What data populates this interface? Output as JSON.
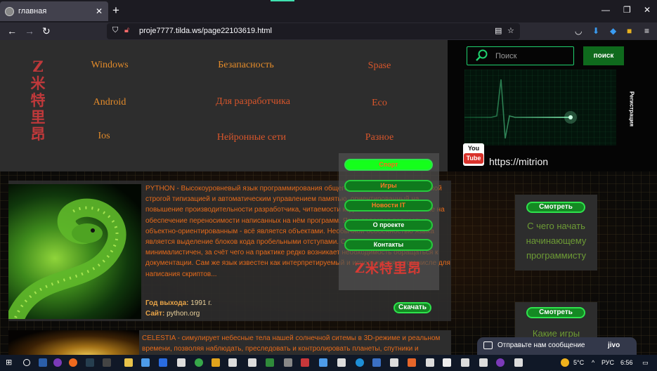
{
  "browser": {
    "tab_title": "главная",
    "tab_close": "✕",
    "new_tab": "+",
    "url": "proje7777.tilda.ws/page22103619.html",
    "window_controls": [
      "—",
      "❐",
      "✕"
    ]
  },
  "header": {
    "logo": "Z米特里昂",
    "nav": [
      {
        "label": "Windows",
        "color": "#e38b2a"
      },
      {
        "label": "Безапасность",
        "color": "#e38b2a"
      },
      {
        "label": "Spase",
        "color": "#d9562b"
      },
      {
        "label": "Android",
        "color": "#e38b2a"
      },
      {
        "label": "Для разработчика",
        "color": "#d9562b"
      },
      {
        "label": "Eco",
        "color": "#d9562b"
      },
      {
        "label": "Ios",
        "color": "#e38b2a"
      },
      {
        "label": "Нейронные сети",
        "color": "#d9562b"
      },
      {
        "label": "Разное",
        "color": "#d9562b"
      }
    ]
  },
  "search": {
    "placeholder": "Поиск",
    "button": "поиск"
  },
  "sidebar": {
    "registration": "Регистрация",
    "youtube_you": "You",
    "youtube_tube": "Tube",
    "youtube_link": "https://mitrion"
  },
  "card1": {
    "description": "PYTHON - Высокоуровневый язык программирования общего назначения с динамической строгой типизацией и автоматическим управлением памятью, ориентированный на повышение производительности разработчика, читаемости кода и его качества, а также на обеспечение переносимости написанных на нём программ. Язык является полностью объектно-ориентированным - всё является объектами. Необычной особенностью языка является выделение блоков кода пробельными отступами. Синтаксис ядра языка минималистичен, за счёт чего на практике редко возникает необходимость обращаться к документации. Сам же язык известен как интерпретируемый и используется в том числе для написания скриптов...",
    "release_label": "Год выхода:",
    "release_value": "1991 г.",
    "site_label": "Сайт:",
    "site_value": "python.org",
    "download": "Скачать"
  },
  "card2": {
    "description": "CELESTIA - симулирует небесные тела нашей солнечной ситемы в 3D-режиме и реальном времени, позволяя наблюдать, преследовать и контролировать планеты, спутники и космические станции во"
  },
  "side_cards": [
    {
      "button": "Смотреть",
      "text": "С чего начать начинающему программисту"
    },
    {
      "button": "Смотреть",
      "text": "Какие игры"
    }
  ],
  "dropdown": {
    "items": [
      {
        "label": "Спорт",
        "style": "hot"
      },
      {
        "label": "Игры",
        "style": "dim"
      },
      {
        "label": "Новости IT",
        "style": "dim"
      },
      {
        "label": "О проекте",
        "style": "nrm"
      },
      {
        "label": "Контакты",
        "style": "nrm"
      }
    ],
    "logo": "Z米特里昂"
  },
  "chat": {
    "label": "Отправьте нам сообщение",
    "brand": "jivo"
  },
  "taskbar": {
    "weather": "5°C",
    "language": "РУС",
    "time": "6:56"
  },
  "colors": {
    "accent_green": "#1fd16e",
    "nav_orange": "#e38b2a",
    "nav_red": "#d9562b",
    "desc_orange": "#e56a1a"
  }
}
